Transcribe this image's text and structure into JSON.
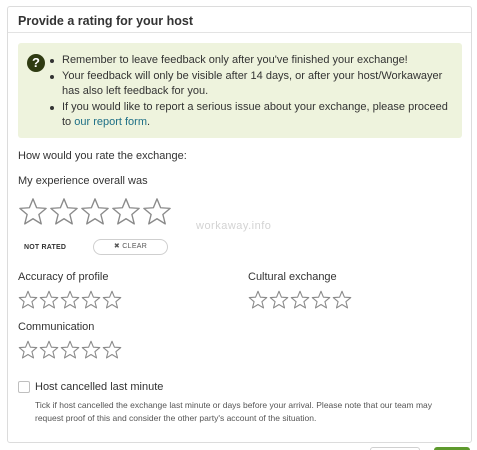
{
  "header": {
    "title": "Provide a rating for your host"
  },
  "info": {
    "icon": "question-circle-icon",
    "items": [
      "Remember to leave feedback only after you've finished your exchange!",
      "Your feedback will only be visible after 14 days, or after your host/Workawayer has also left feedback for you.",
      "If you would like to report a serious issue about your exchange, please proceed to "
    ],
    "report_link": "our report form",
    "after_link": "."
  },
  "question": "How would you rate the exchange:",
  "overall": {
    "label": "My experience overall was",
    "rating": 0,
    "max": 5,
    "status": "NOT RATED",
    "clear_label": "✖ CLEAR"
  },
  "watermark": "workaway.info",
  "categories": {
    "accuracy": {
      "label": "Accuracy of profile",
      "rating": 0,
      "max": 5
    },
    "cultural": {
      "label": "Cultural exchange",
      "rating": 0,
      "max": 5
    },
    "communication": {
      "label": "Communication",
      "rating": 0,
      "max": 5
    }
  },
  "cancelled": {
    "label": "Host cancelled last minute",
    "checked": false,
    "help": "Tick if host cancelled the exchange last minute or days before your arrival. Please note that our team may request proof of this and consider the other party's account of the situation."
  },
  "colors": {
    "info_bg": "#eef3dd",
    "link": "#1d6f86",
    "star_outline": "#8a8a8a",
    "button_green": "#5e9a2d"
  }
}
